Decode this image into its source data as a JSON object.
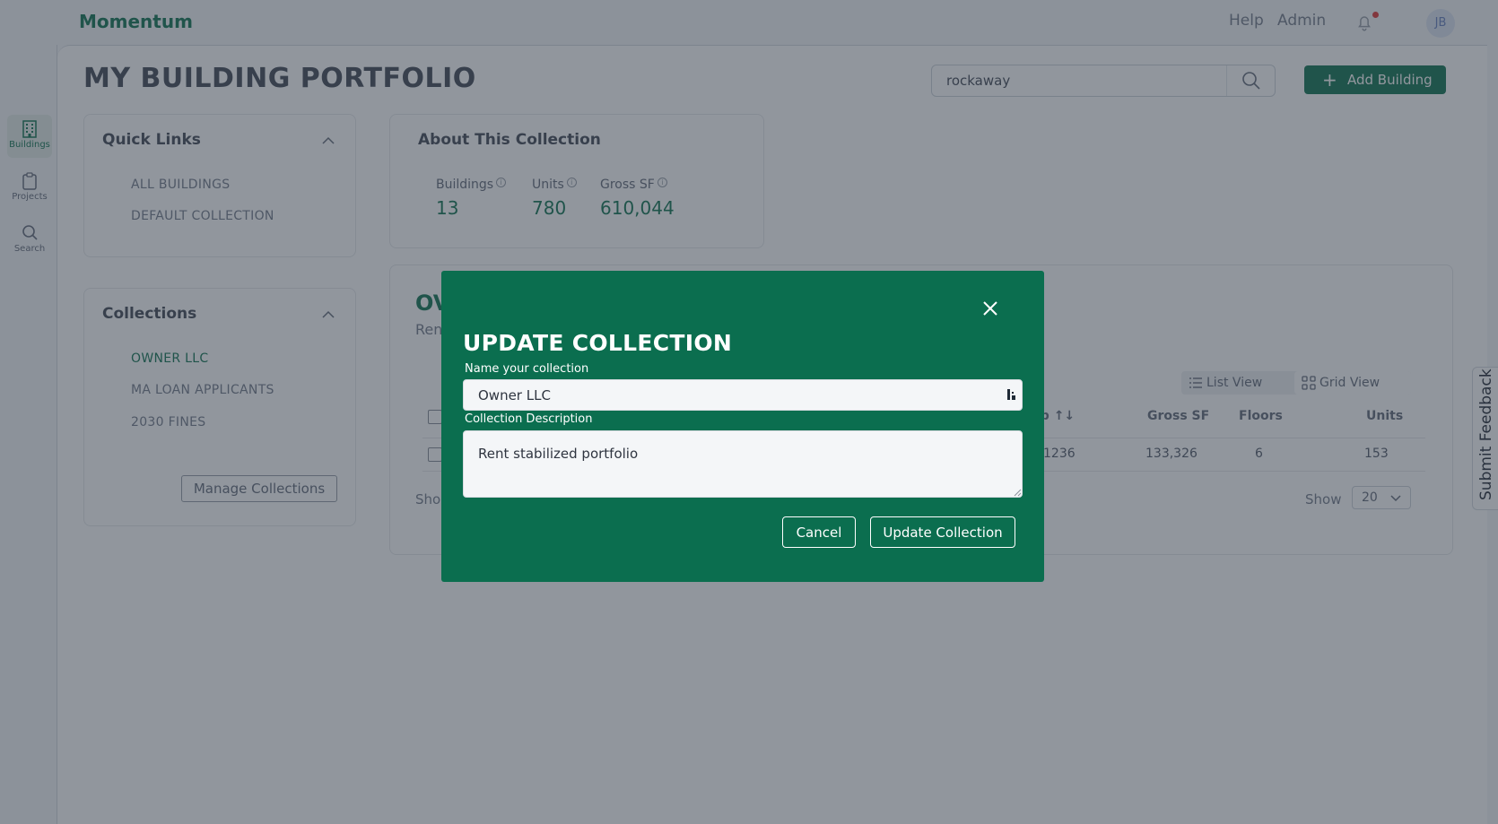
{
  "header": {
    "brand": "Momentum",
    "nav": [
      "Help",
      "Admin"
    ],
    "notifications_icon": "bell-icon",
    "avatar_initials": "JB"
  },
  "rail": {
    "items": [
      {
        "label": "Buildings",
        "icon": "building-icon",
        "active": true
      },
      {
        "label": "Projects",
        "icon": "clipboard-icon",
        "active": false
      },
      {
        "label": "Search",
        "icon": "search-icon",
        "active": false
      }
    ]
  },
  "page": {
    "title": "MY BUILDING PORTFOLIO",
    "search_value": "rockaway",
    "add_building_label": "Add Building"
  },
  "quick_links": {
    "title": "Quick Links",
    "items": [
      "ALL BUILDINGS",
      "DEFAULT COLLECTION"
    ]
  },
  "collections": {
    "title": "Collections",
    "items": [
      "OWNER LLC",
      "MA LOAN APPLICANTS",
      "2030 FINES"
    ],
    "active": "OWNER LLC",
    "manage_label": "Manage Collections"
  },
  "about": {
    "title": "About This Collection",
    "stats": [
      {
        "label": "Buildings",
        "value": "13"
      },
      {
        "label": "Units",
        "value": "780"
      },
      {
        "label": "Gross SF",
        "value": "610,044"
      }
    ]
  },
  "overview": {
    "title_partial": "OV",
    "subtitle_partial": "Ren",
    "views": [
      "List View",
      "Grid View"
    ],
    "active_view": "Grid View",
    "columns": [
      "ip ↑↓",
      "Gross SF",
      "Floors",
      "Units"
    ],
    "rows": [
      {
        "zip": "1236",
        "gross_sf": "133,326",
        "floors": "6",
        "units": "153"
      }
    ],
    "show_partial": "Sho",
    "show_label": "Show",
    "page_size": "20"
  },
  "feedback": {
    "label": "Submit Feedback"
  },
  "modal": {
    "title": "UPDATE COLLECTION",
    "name_label": "Name your collection",
    "name_value": "Owner LLC",
    "description_label": "Collection Description",
    "description_value": "Rent stabilized portfolio",
    "cancel_label": "Cancel",
    "update_label": "Update Collection"
  },
  "colors": {
    "brand": "#1d7a5a",
    "modal_bg": "#0b6e4f",
    "notification_dot": "#e04040"
  }
}
